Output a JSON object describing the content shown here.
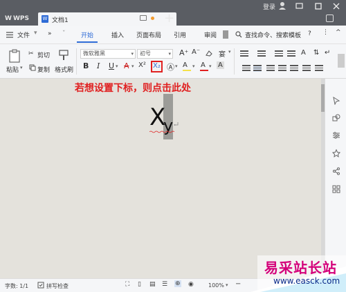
{
  "titlebar": {
    "app_name": "WPS",
    "tab_title": "文档1",
    "login": "登录",
    "add_tab": "+"
  },
  "menu": {
    "file": "文件",
    "more": "»",
    "items": [
      "开始",
      "插入",
      "页面布局",
      "引用",
      "审阅"
    ],
    "active": "开始",
    "search_placeholder": "查找命令、搜索模板",
    "help": "?",
    "colors": {
      "accent": "#2e6bd6",
      "titlebar": "#5a5d63"
    }
  },
  "ribbon": {
    "paste": "粘贴",
    "cut": "剪切",
    "copy": "复制",
    "format_painter": "格式刷",
    "font_name": "微软雅黑",
    "font_size": "初号",
    "bold": "B",
    "italic": "I",
    "underline": "U",
    "strike": "A",
    "superscript": "X²",
    "subscript": "X₂",
    "font_color": "A",
    "highlight": "A"
  },
  "document": {
    "annotation": "若想设置下标，则点击此处",
    "base_char": "X",
    "sub_char": "y",
    "annotation_color": "#e02020"
  },
  "statusbar": {
    "word_count": "字数: 1/1",
    "spellcheck": "拼写检查",
    "zoom": "100%"
  },
  "watermark": {
    "text": "易采站长站",
    "url": "www.easck.com"
  }
}
